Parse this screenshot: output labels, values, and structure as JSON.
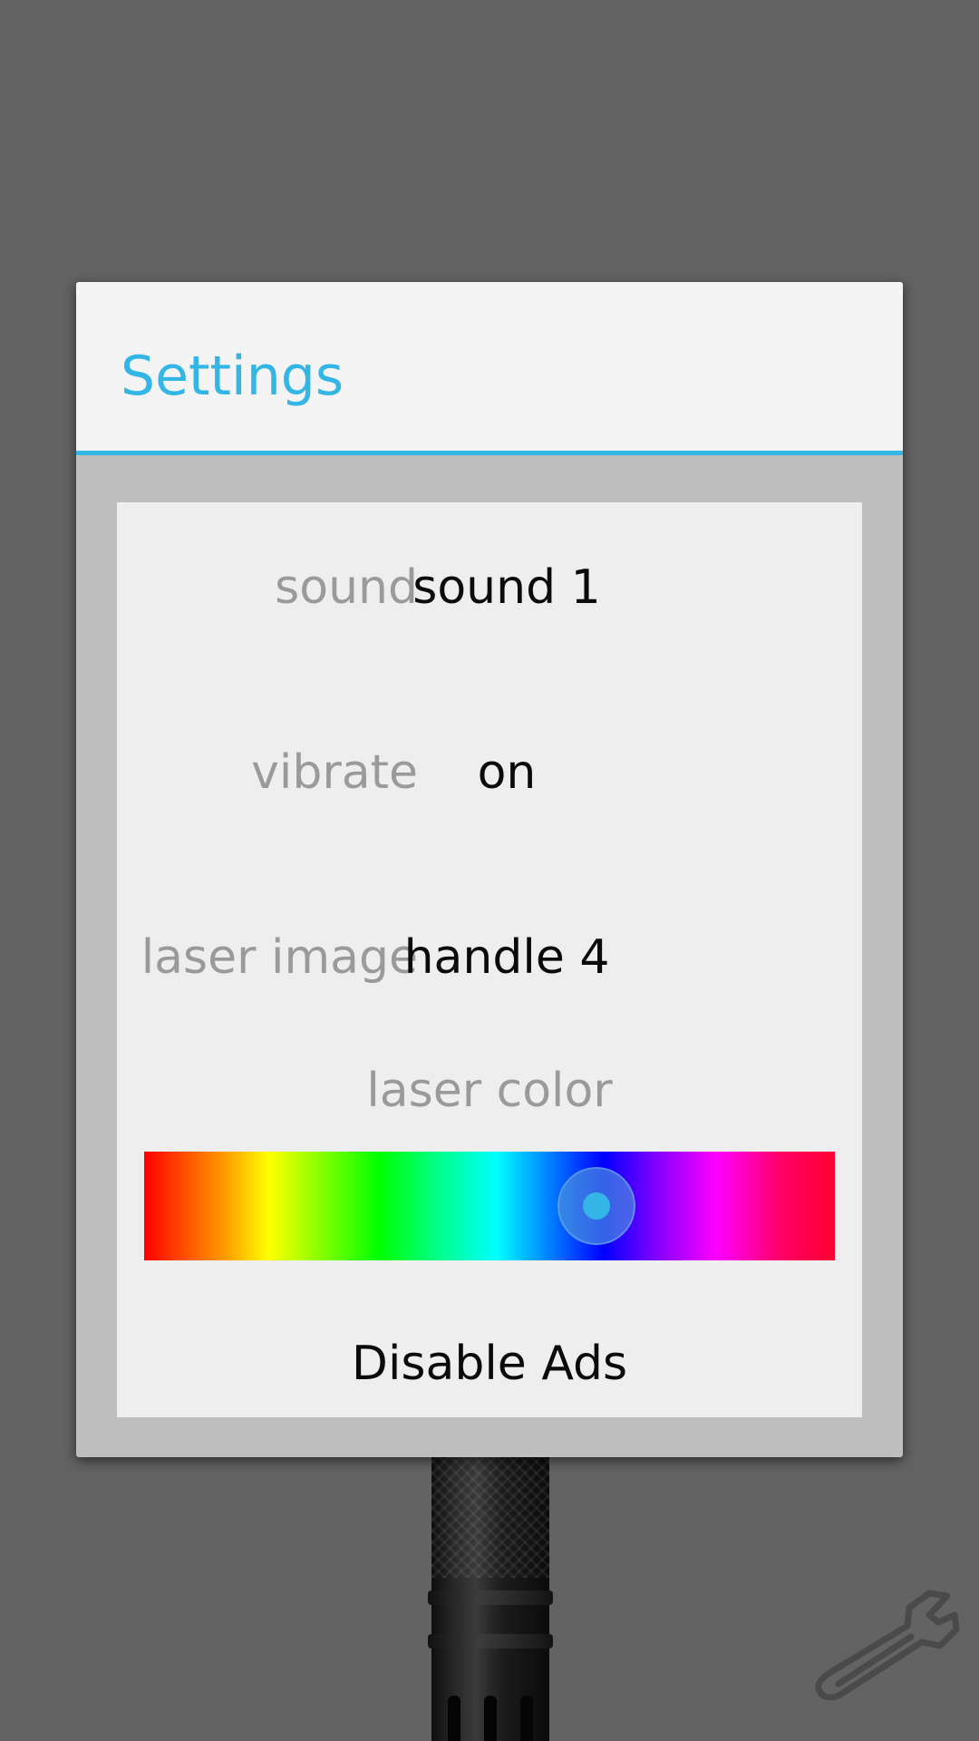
{
  "dialog": {
    "title": "Settings",
    "accent_color": "#33b5e5"
  },
  "settings": [
    {
      "label": "sound",
      "value": "sound 1"
    },
    {
      "label": "vibrate",
      "value": "on"
    },
    {
      "label": "laser image",
      "value": "handle 4"
    }
  ],
  "laser_color": {
    "label": "laser color",
    "selected_hue_fraction": 0.655
  },
  "disable_ads_label": "Disable Ads",
  "background": {
    "color": "#636363",
    "icons": [
      "flashlight-handle",
      "wrench-icon"
    ]
  }
}
